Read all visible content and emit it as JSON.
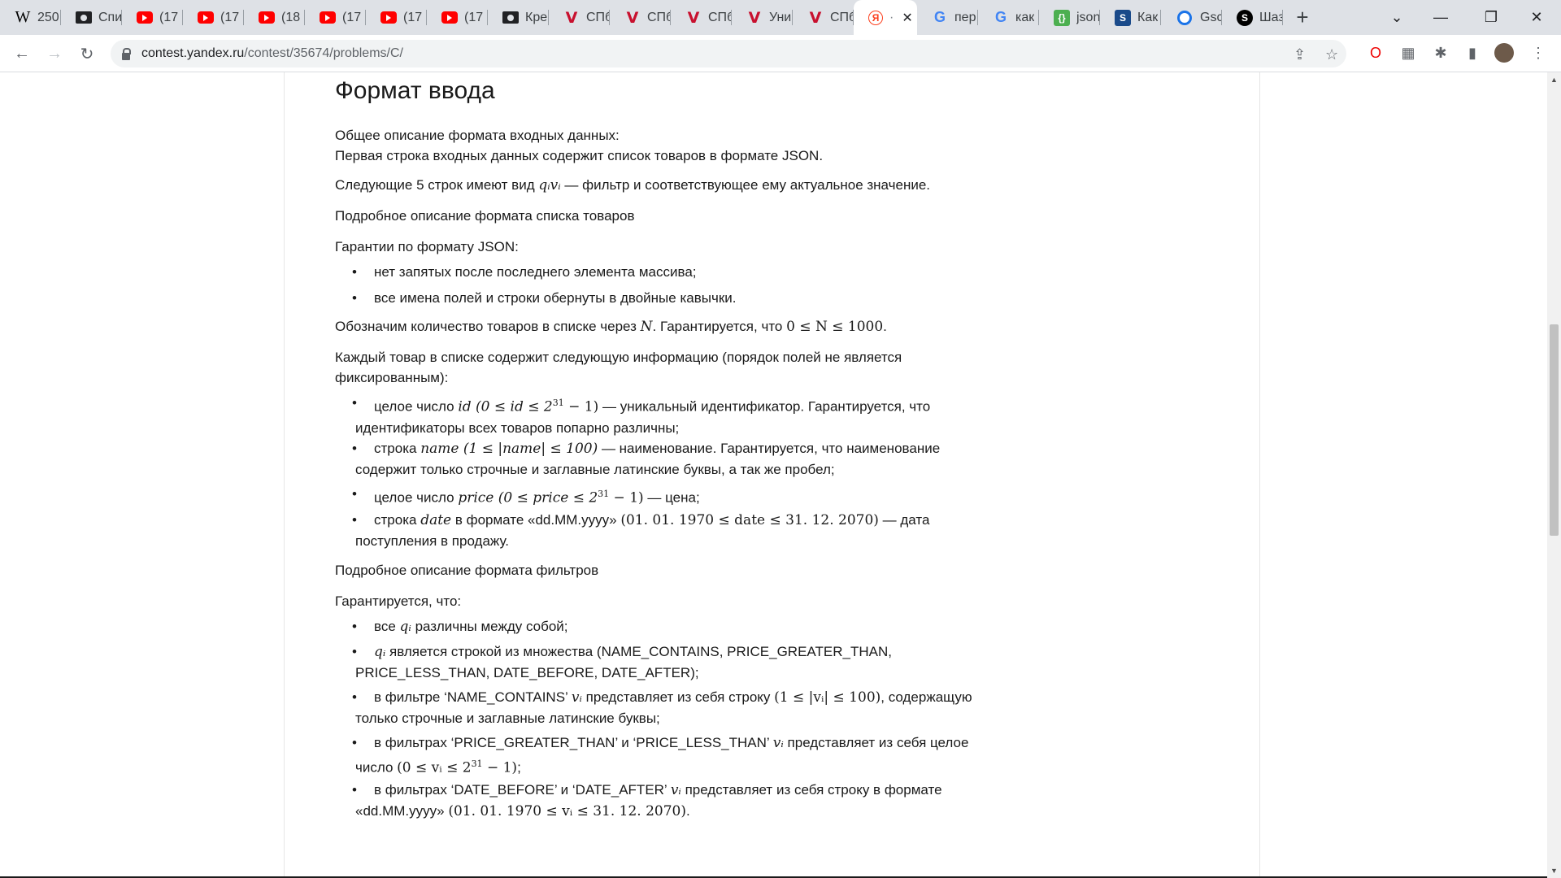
{
  "browser": {
    "tabs": [
      {
        "icon": "wikipedia-icon",
        "title": "250"
      },
      {
        "icon": "video-camera-icon",
        "title": "Спи"
      },
      {
        "icon": "youtube-icon",
        "title": "(17"
      },
      {
        "icon": "youtube-icon",
        "title": "(17"
      },
      {
        "icon": "youtube-icon",
        "title": "(18"
      },
      {
        "icon": "youtube-icon",
        "title": "(17"
      },
      {
        "icon": "youtube-icon",
        "title": "(17"
      },
      {
        "icon": "youtube-icon",
        "title": "(17"
      },
      {
        "icon": "video-camera-icon",
        "title": "Кре"
      },
      {
        "icon": "v-logo-icon",
        "title": "СПб"
      },
      {
        "icon": "v-logo-icon",
        "title": "СПб"
      },
      {
        "icon": "v-logo-icon",
        "title": "СПб"
      },
      {
        "icon": "v-logo-icon",
        "title": "Уни"
      },
      {
        "icon": "v-logo-icon",
        "title": "СПб"
      },
      {
        "icon": "yandex-icon",
        "title": "·",
        "active": true
      },
      {
        "icon": "google-icon",
        "title": "пер"
      },
      {
        "icon": "google-icon",
        "title": "как"
      },
      {
        "icon": "json-icon",
        "title": "json"
      },
      {
        "icon": "stackoverflow-icon",
        "title": "Как"
      },
      {
        "icon": "gsc-icon",
        "title": "Gsc"
      },
      {
        "icon": "shazam-icon",
        "title": "Шаз"
      }
    ],
    "url_host": "contest.yandex.ru",
    "url_path": "/contest/35674/problems/C/"
  },
  "article": {
    "heading": "Формат ввода",
    "p1": "Общее описание формата входных данных:",
    "p2": "Первая строка входных данных содержит список товаров в формате JSON.",
    "p3_a": "Следующие 5 строк имеют вид ",
    "p3_math": "qᵢvᵢ",
    "p3_b": " — фильтр и соответствующее ему актуальное значение.",
    "p4": "Подробное описание формата списка товаров",
    "p5": "Гарантии по формату JSON:",
    "json_items": [
      "нет запятых после последнего элемента массива;",
      "все имена полей и строки обернуты в двойные кавычки."
    ],
    "p6_a": "Обозначим количество товаров в списке через ",
    "p6_math_n": "N",
    "p6_b": ". Гарантируется, что ",
    "p6_math_range": "0 ≤ N ≤ 1000",
    "p6_c": ".",
    "p7": "Каждый товар в списке содержит следующую информацию (порядок полей не является фиксированным):",
    "field_id_a": "целое число ",
    "field_id_math": "id (0 ≤ id ≤ 2",
    "field_id_sup": "31",
    "field_id_math2": " − 1)",
    "field_id_b": " — уникальный идентификатор. Гарантируется, что идентификаторы всех товаров попарно различны;",
    "field_name_a": "строка ",
    "field_name_math": "name (1 ≤ |name| ≤ 100)",
    "field_name_b": " — наименование. Гарантируется, что наименование содержит только строчные и заглавные латинские буквы, а так же пробел;",
    "field_price_a": "целое число ",
    "field_price_math": "price (0 ≤ price ≤ 2",
    "field_price_sup": "31",
    "field_price_math2": " − 1)",
    "field_price_b": " — цена;",
    "field_date_a": "строка ",
    "field_date_math1": "date",
    "field_date_b": " в формате «dd.MM.yyyy» ",
    "field_date_math2": "(01. 01. 1970 ≤ date ≤ 31. 12. 2070)",
    "field_date_c": " — дата поступления в продажу.",
    "p8": "Подробное описание формата фильтров",
    "p9": "Гарантируется, что:",
    "filter1_a": "все ",
    "filter1_math": "qᵢ",
    "filter1_b": " различны между собой;",
    "filter2_math": "qᵢ",
    "filter2_b": " является строкой из множества (NAME_CONTAINS, PRICE_GREATER_THAN, PRICE_LESS_THAN, DATE_BEFORE, DATE_AFTER);",
    "filter3_a": "в фильтре ‘NAME_CONTAINS’ ",
    "filter3_math": "vᵢ",
    "filter3_b": " представляет из себя строку ",
    "filter3_math2": "(1 ≤ |vᵢ| ≤ 100)",
    "filter3_c": ", содержащую только строчные и заглавные латинские буквы;",
    "filter4_a": "в фильтрах ‘PRICE_GREATER_THAN’ и ‘PRICE_LESS_THAN’ ",
    "filter4_math": "vᵢ",
    "filter4_b": " представляет из себя целое число ",
    "filter4_math2": "(0 ≤ vᵢ ≤ 2",
    "filter4_sup": "31",
    "filter4_math3": " − 1)",
    "filter4_c": ";",
    "filter5_a": "в фильтрах ‘DATE_BEFORE’ и ‘DATE_AFTER’ ",
    "filter5_math": "vᵢ",
    "filter5_b": " представляет из себя строку в формате «dd.MM.yyyy» ",
    "filter5_math2": "(01. 01. 1970 ≤ vᵢ ≤ 31. 12. 2070)",
    "filter5_c": "."
  }
}
